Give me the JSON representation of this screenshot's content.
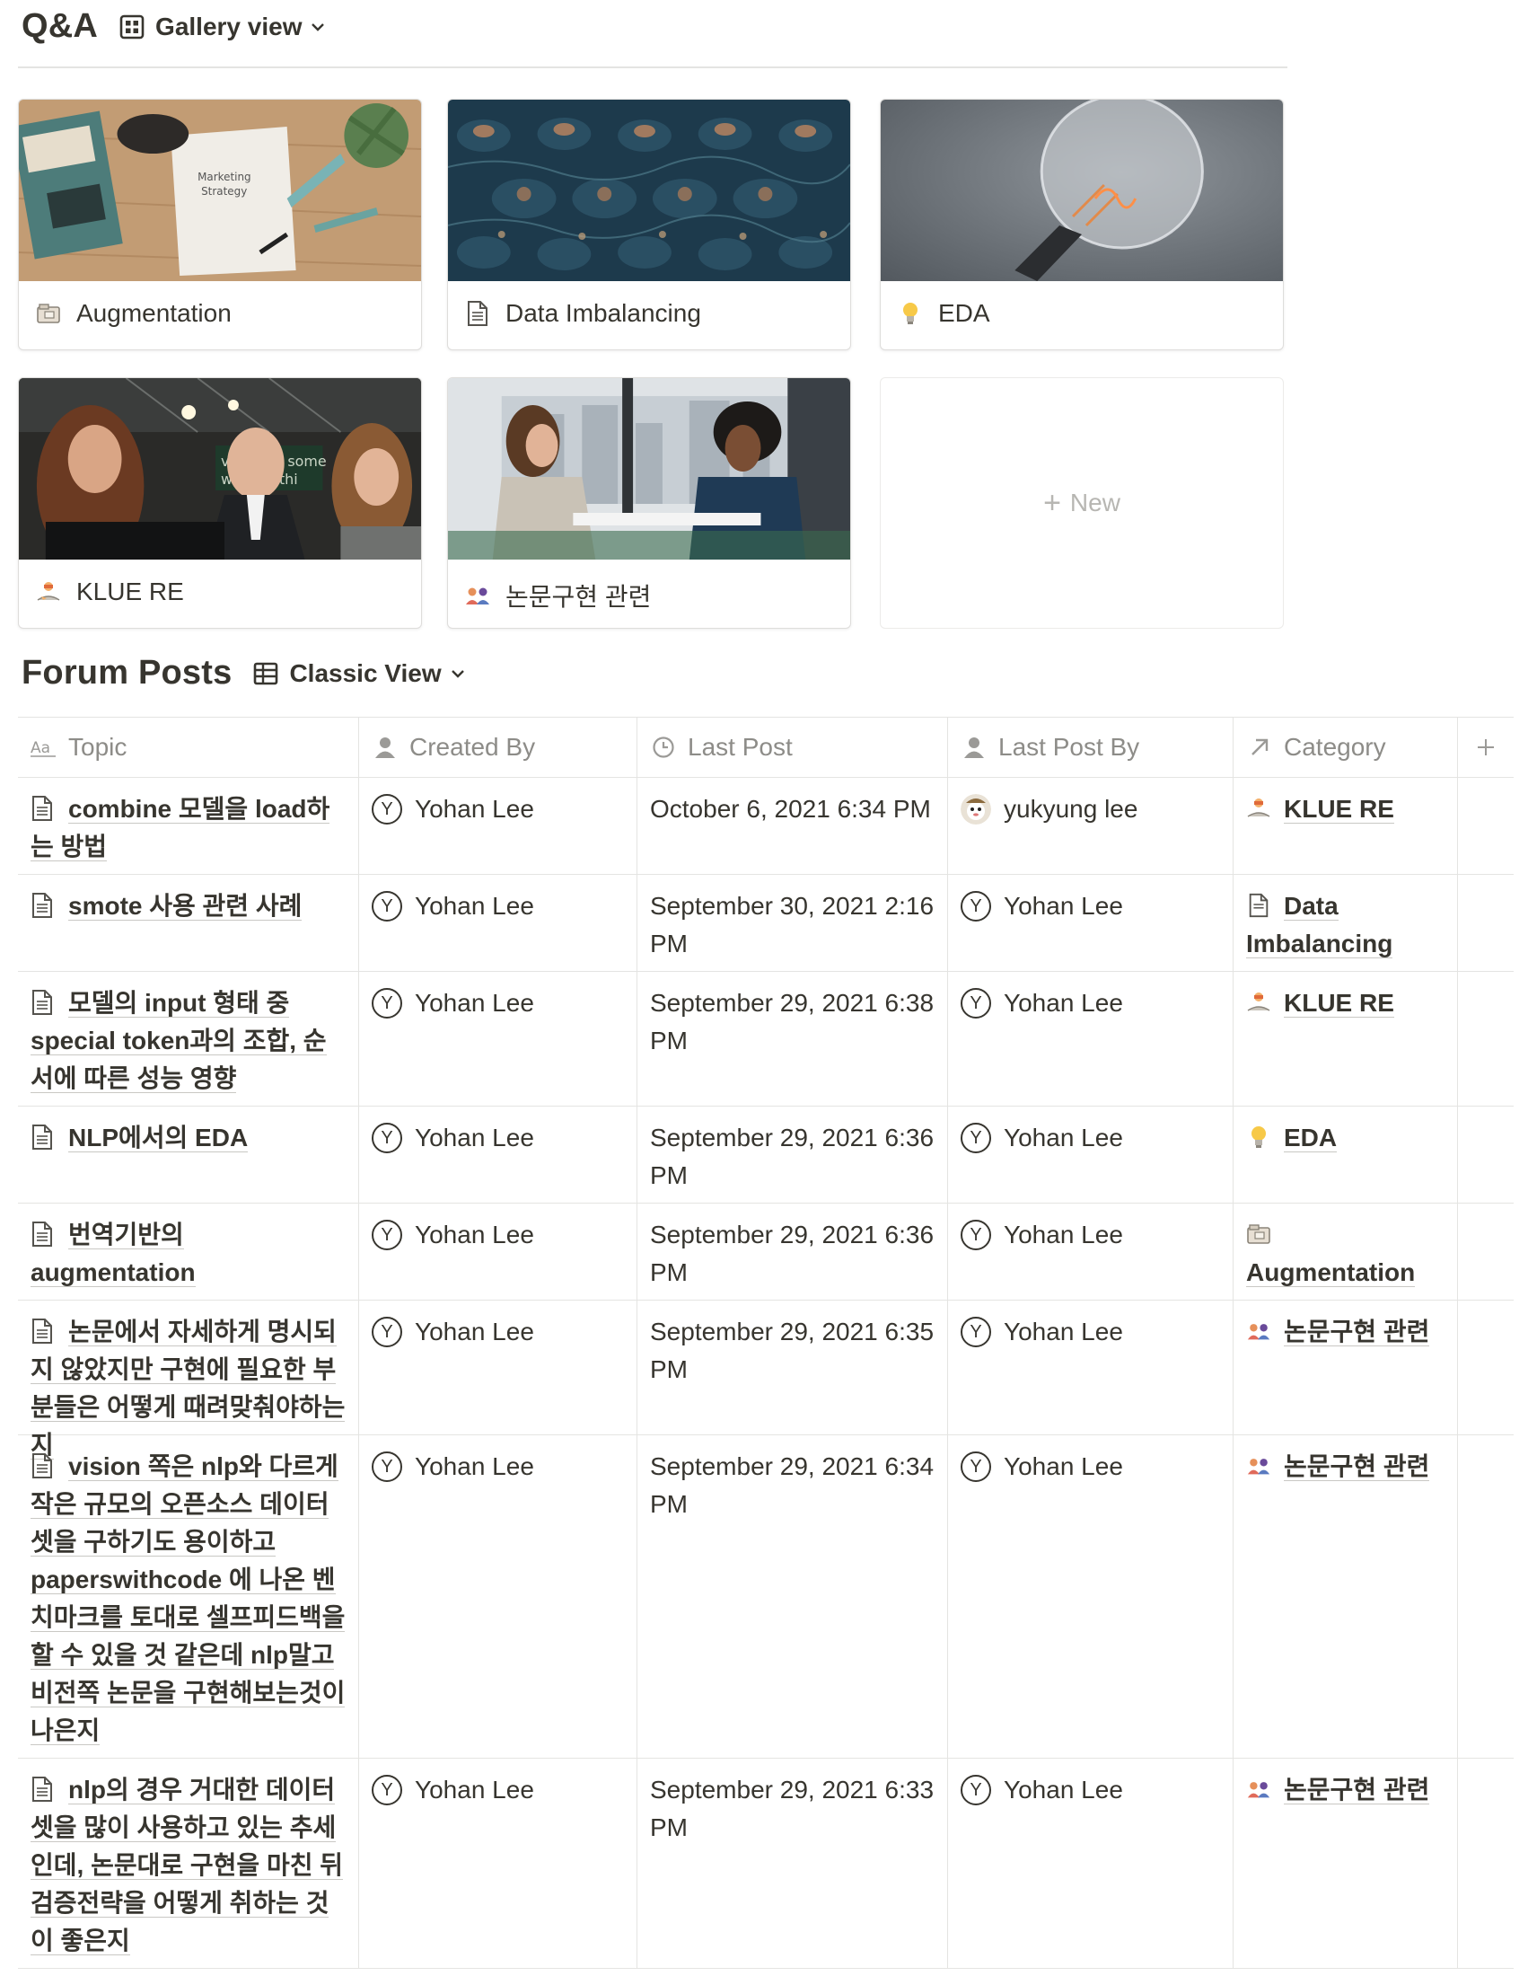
{
  "qa": {
    "title": "Q&A",
    "view_label": "Gallery view",
    "cards": [
      {
        "label": "Augmentation",
        "icon": "card-index-dividers-icon"
      },
      {
        "label": "Data Imbalancing",
        "icon": "document-icon"
      },
      {
        "label": "EDA",
        "icon": "lightbulb-icon"
      },
      {
        "label": "KLUE RE",
        "icon": "raising-hand-icon"
      },
      {
        "label": "논문구현 관련",
        "icon": "people-icon"
      }
    ],
    "new_label": "New"
  },
  "forum": {
    "title": "Forum Posts",
    "view_label": "Classic View",
    "columns": [
      "Topic",
      "Created By",
      "Last Post",
      "Last Post By",
      "Category"
    ],
    "rows": [
      {
        "topic": "combine 모델을 load하는 방법",
        "created_by": "Yohan Lee",
        "last_post": "October 6, 2021 6:34 PM",
        "last_post_by": "yukyung lee",
        "category": "KLUE RE"
      },
      {
        "topic": "smote 사용 관련 사례",
        "created_by": "Yohan Lee",
        "last_post": "September 30, 2021 2:16 PM",
        "last_post_by": "Yohan Lee",
        "category": "Data Imbalancing"
      },
      {
        "topic": "모델의 input 형태 중 special token과의 조합, 순서에 따른 성능 영향",
        "created_by": "Yohan Lee",
        "last_post": "September 29, 2021 6:38 PM",
        "last_post_by": "Yohan Lee",
        "category": "KLUE RE"
      },
      {
        "topic": "NLP에서의 EDA",
        "created_by": "Yohan Lee",
        "last_post": "September 29, 2021 6:36 PM",
        "last_post_by": "Yohan Lee",
        "category": "EDA"
      },
      {
        "topic": "번역기반의 augmentation",
        "created_by": "Yohan Lee",
        "last_post": "September 29, 2021 6:36 PM",
        "last_post_by": "Yohan Lee",
        "category": "Augmentation"
      },
      {
        "topic": "논문에서 자세하게 명시되지 않았지만 구현에 필요한 부분들은 어떻게 때려맞춰야하는지",
        "created_by": "Yohan Lee",
        "last_post": "September 29, 2021 6:35 PM",
        "last_post_by": "Yohan Lee",
        "category": "논문구현 관련"
      },
      {
        "topic": "vision 쪽은 nlp와 다르게 작은 규모의 오픈소스 데이터셋을 구하기도 용이하고 paperswithcode 에 나온 벤치마크를 토대로 셀프피드백을 할 수 있을 것 같은데 nlp말고 비전쪽 논문을 구현해보는것이 나은지",
        "created_by": "Yohan Lee",
        "last_post": "September 29, 2021 6:34 PM",
        "last_post_by": "Yohan Lee",
        "category": "논문구현 관련"
      },
      {
        "topic": "nlp의 경우 거대한 데이터셋을 많이 사용하고 있는 추세인데, 논문대로 구현을 마친 뒤 검증전략을 어떻게 취하는 것이 좋은지",
        "created_by": "Yohan Lee",
        "last_post": "September 29, 2021 6:33 PM",
        "last_post_by": "Yohan Lee",
        "category": "논문구현 관련"
      }
    ]
  }
}
